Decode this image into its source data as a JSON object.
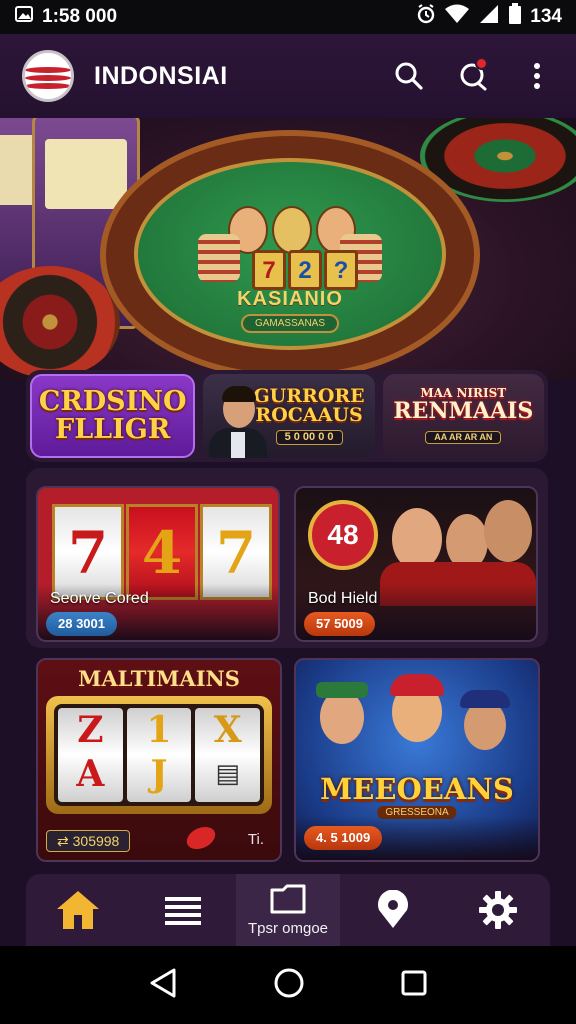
{
  "status_bar": {
    "time": "1:58 000",
    "battery": "134"
  },
  "header": {
    "app_title": "INDONSIAI",
    "icons": [
      "search-icon",
      "chat-icon",
      "more-vert-icon"
    ]
  },
  "hero": {
    "table_brand": "KASIANIO",
    "table_sub": "GAMASSANAS",
    "reels": [
      "7",
      "2",
      "?"
    ]
  },
  "categories": [
    {
      "title_line1": "CRDSINO",
      "title_line2": "FLLIGR"
    },
    {
      "title_line1": "GURRORE",
      "title_line2": "ROCAAUS",
      "badge": "5 0  00 0 0"
    },
    {
      "title_line1": "MAA NIRIST",
      "title_line2": "RENMAAIS",
      "badge": "AA AR AR AN"
    }
  ],
  "games": [
    {
      "label": "Seorve Cored",
      "badge": "28 3001",
      "reels": [
        "7",
        "4",
        "7"
      ]
    },
    {
      "label": "Bod Hield",
      "badge": "57 5009",
      "chip_text": "48"
    },
    {
      "title": "MALTIMAINS",
      "value": "⇄ 305998",
      "note": "Ti.",
      "reels": [
        "Z",
        "1",
        "X"
      ],
      "reels_row2": [
        "A",
        "J",
        ""
      ]
    },
    {
      "title": "MEEOEANS",
      "sub": "GRESSEONA",
      "badge": "4. 5 1009"
    }
  ],
  "bottom_nav": [
    {
      "icon": "home-icon",
      "label": ""
    },
    {
      "icon": "menu-list-icon",
      "label": ""
    },
    {
      "icon": "folder-icon",
      "label": "Tpsr omgoe"
    },
    {
      "icon": "location-pin-icon",
      "label": ""
    },
    {
      "icon": "settings-icon",
      "label": ""
    }
  ],
  "colors": {
    "background": "#1d0f26",
    "header": "#2d1639",
    "accent_gold": "#ffd246",
    "accent_purple": "#8a38c7",
    "badge_blue": "#2f6fb3",
    "badge_orange": "#d6481a",
    "notification": "#e2262a"
  }
}
